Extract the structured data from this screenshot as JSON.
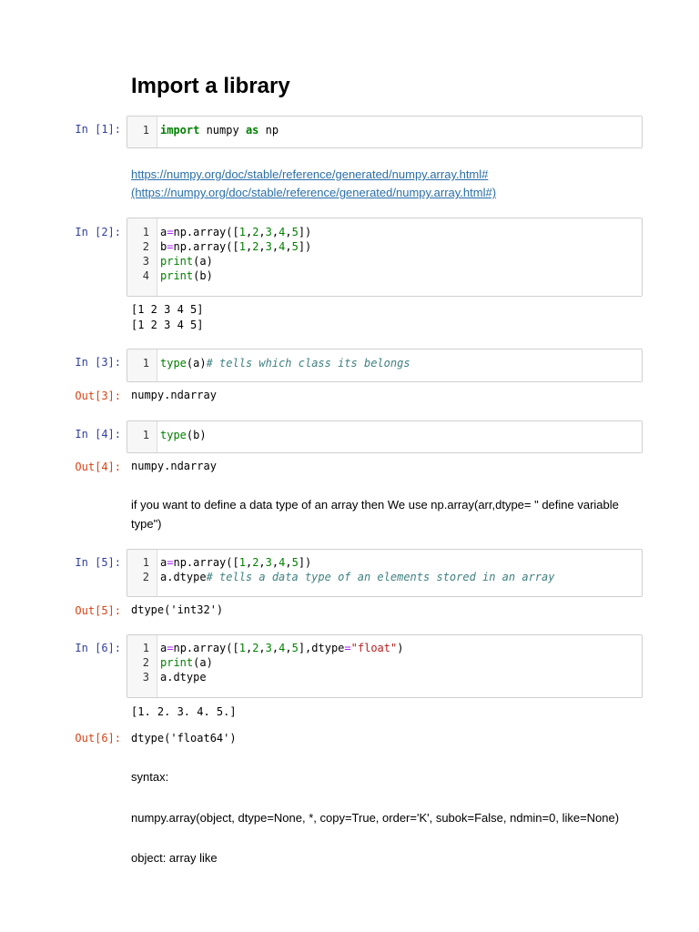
{
  "title": "Import a library",
  "link": {
    "line1": "https://numpy.org/doc/stable/reference/generated/numpy.array.html#",
    "line2": "(https://numpy.org/doc/stable/reference/generated/numpy.array.html#)"
  },
  "cells": {
    "c1": {
      "prompt": "In [1]:"
    },
    "c2": {
      "prompt": "In [2]:",
      "output": "[1 2 3 4 5]\n[1 2 3 4 5]"
    },
    "c3": {
      "prompt": "In [3]:",
      "out_prompt": "Out[3]:",
      "output": "numpy.ndarray"
    },
    "c4": {
      "prompt": "In [4]:",
      "out_prompt": "Out[4]:",
      "output": "numpy.ndarray"
    },
    "c5": {
      "prompt": "In [5]:",
      "out_prompt": "Out[5]:",
      "output": "dtype('int32')"
    },
    "c6": {
      "prompt": "In [6]:",
      "stdout": "[1. 2. 3. 4. 5.]",
      "out_prompt": "Out[6]:",
      "output": "dtype('float64')"
    }
  },
  "markdown": {
    "dtype_note": "if you want to define a data type of an array then We use np.array(arr,dtype= \" define variable type\")",
    "syntax_label": "syntax:",
    "signature": "numpy.array(object, dtype=None, *, copy=True, order='K', subok=False, ndmin=0, like=None)",
    "object_desc": "object: array like"
  },
  "colors": {
    "in_prompt": "#303f9f",
    "out_prompt": "#d84315",
    "keyword": "#008000",
    "comment": "#408080",
    "string": "#ba2121",
    "link": "#296eaa"
  }
}
